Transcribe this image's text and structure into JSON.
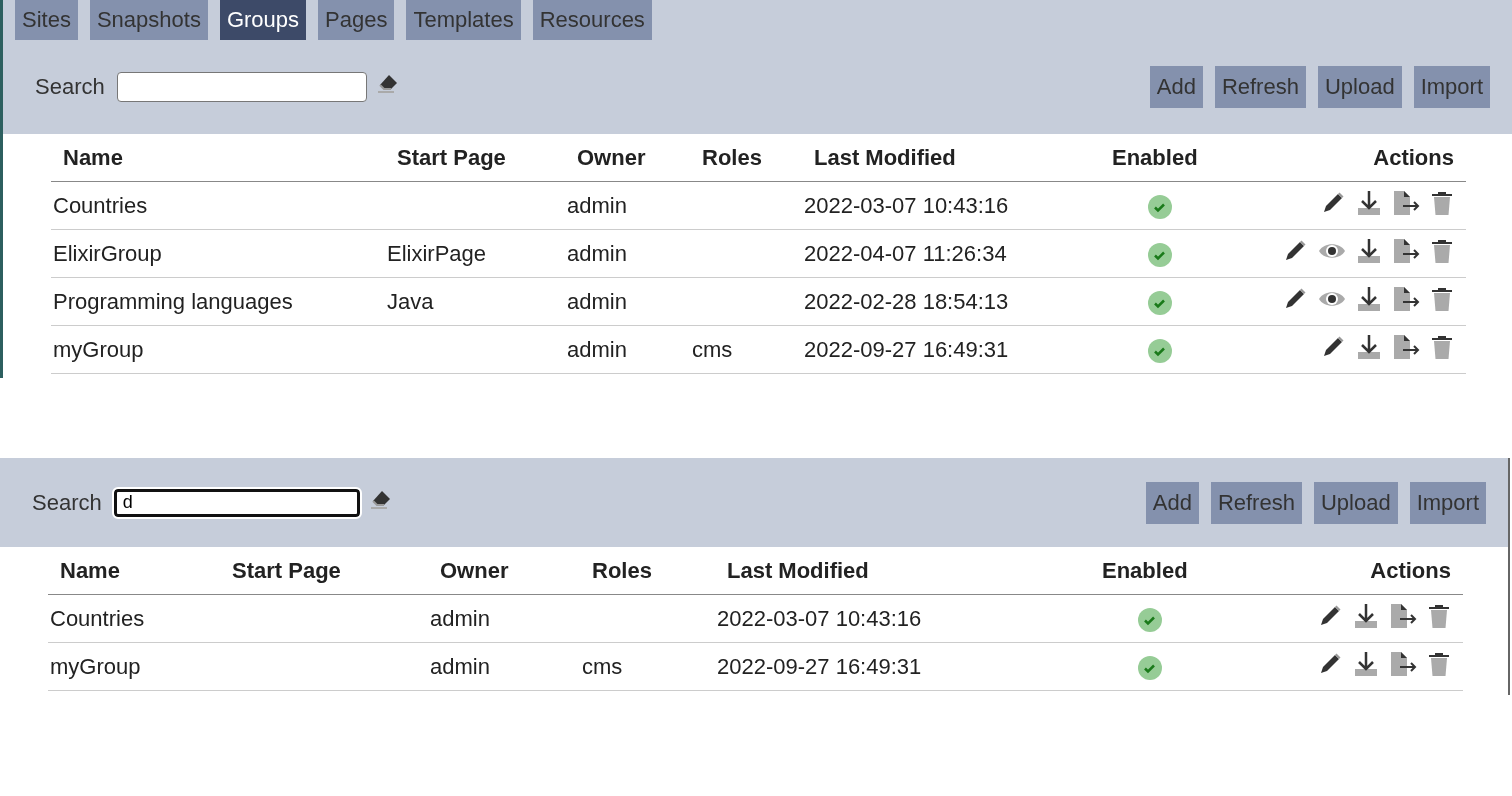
{
  "tabs": [
    {
      "label": "Sites",
      "selected": false
    },
    {
      "label": "Snapshots",
      "selected": false
    },
    {
      "label": "Groups",
      "selected": true
    },
    {
      "label": "Pages",
      "selected": false
    },
    {
      "label": "Templates",
      "selected": false
    },
    {
      "label": "Resources",
      "selected": false
    }
  ],
  "panels": [
    {
      "search": {
        "label": "Search",
        "focused": false
      },
      "buttons": [
        "Add",
        "Refresh",
        "Upload",
        "Import"
      ],
      "columns": [
        "Name",
        "Start Page",
        "Owner",
        "Roles",
        "Last Modified",
        "Enabled",
        "Actions"
      ],
      "rows": [
        {
          "name": "Countries",
          "start_page": "",
          "owner": "admin",
          "roles": "",
          "last_modified": "2022-03-07 10:43:16",
          "enabled": true,
          "viewable": false
        },
        {
          "name": "ElixirGroup",
          "start_page": "ElixirPage",
          "owner": "admin",
          "roles": "",
          "last_modified": "2022-04-07 11:26:34",
          "enabled": true,
          "viewable": true
        },
        {
          "name": "Programming languages",
          "start_page": "Java",
          "owner": "admin",
          "roles": "",
          "last_modified": "2022-02-28 18:54:13",
          "enabled": true,
          "viewable": true
        },
        {
          "name": "myGroup",
          "start_page": "",
          "owner": "admin",
          "roles": "cms",
          "last_modified": "2022-09-27 16:49:31",
          "enabled": true,
          "viewable": false
        }
      ]
    },
    {
      "search": {
        "label": "Search",
        "value": "d",
        "focused": true
      },
      "buttons": [
        "Add",
        "Refresh",
        "Upload",
        "Import"
      ],
      "columns": [
        "Name",
        "Start Page",
        "Owner",
        "Roles",
        "Last Modified",
        "Enabled",
        "Actions"
      ],
      "rows": [
        {
          "name": "Countries",
          "start_page": "",
          "owner": "admin",
          "roles": "",
          "last_modified": "2022-03-07 10:43:16",
          "enabled": true,
          "viewable": false
        },
        {
          "name": "myGroup",
          "start_page": "",
          "owner": "admin",
          "roles": "cms",
          "last_modified": "2022-09-27 16:49:31",
          "enabled": true,
          "viewable": false
        }
      ]
    }
  ]
}
